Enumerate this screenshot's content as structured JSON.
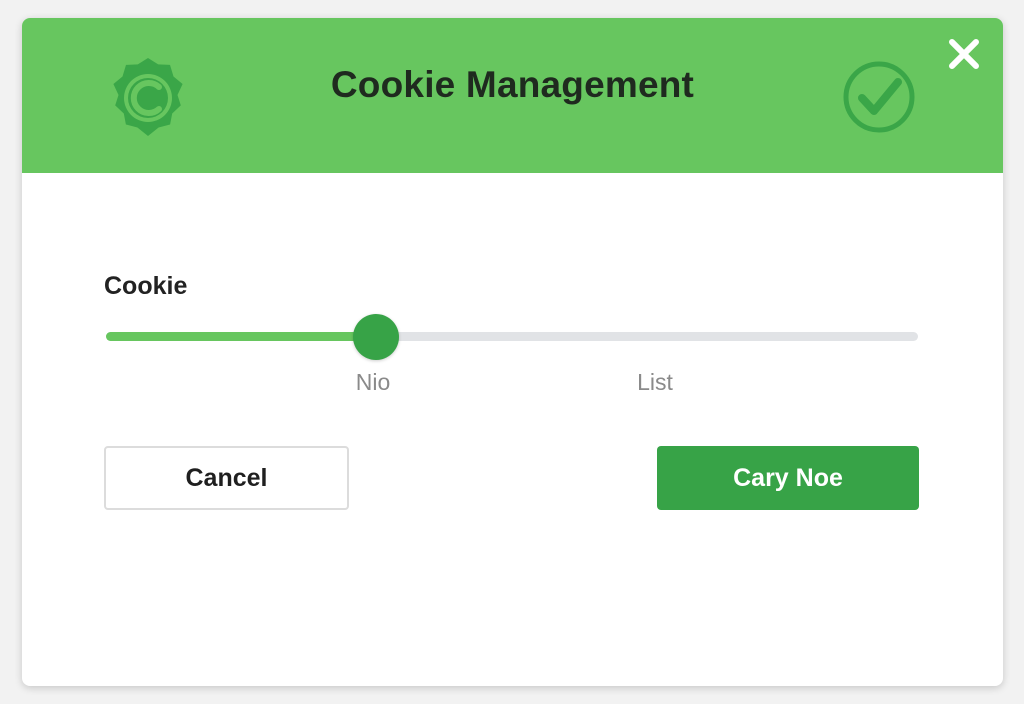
{
  "dialog": {
    "title": "Cookie Management",
    "icons": {
      "left": "cookie-badge-icon",
      "right": "check-circle-icon",
      "close": "close-icon"
    }
  },
  "slider": {
    "label": "Cookie",
    "value_fraction": 0.333,
    "ticks": [
      "Nio",
      "List"
    ]
  },
  "buttons": {
    "cancel_label": "Cancel",
    "primary_label": "Cary Noe"
  },
  "colors": {
    "header": "#67c65f",
    "primary": "#37a347",
    "icon_dark": "#3aa648"
  }
}
